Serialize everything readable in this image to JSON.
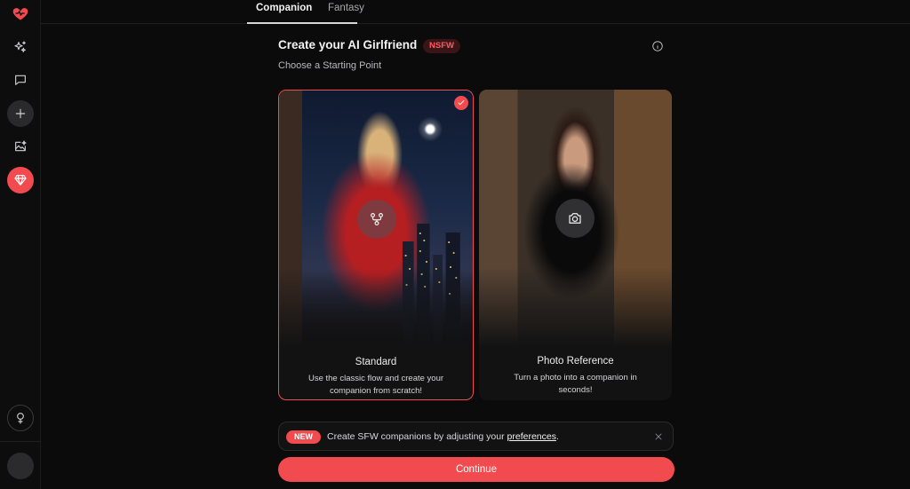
{
  "sidebar": {
    "items": [
      {
        "name": "logo-heart-icon"
      },
      {
        "name": "sparkles-icon"
      },
      {
        "name": "chat-icon"
      },
      {
        "name": "plus-icon"
      },
      {
        "name": "image-sparkle-icon"
      },
      {
        "name": "diamond-icon"
      },
      {
        "name": "gender-icon"
      }
    ]
  },
  "tabs": [
    {
      "label": "Companion",
      "active": true
    },
    {
      "label": "Fantasy",
      "active": false
    }
  ],
  "header": {
    "title": "Create your AI Girlfriend",
    "badge": "NSFW",
    "subtitle": "Choose a Starting Point"
  },
  "cards": [
    {
      "title": "Standard",
      "description": "Use the classic flow and create your companion from scratch!",
      "selected": true,
      "icon": "flow-icon"
    },
    {
      "title": "Photo Reference",
      "description": "Turn a photo into a companion in seconds!",
      "selected": false,
      "icon": "camera-icon"
    }
  ],
  "banner": {
    "badge": "NEW",
    "text_before": "Create SFW companions by adjusting your ",
    "link": "preferences",
    "text_after": "."
  },
  "continue_label": "Continue",
  "colors": {
    "accent": "#f24b4f",
    "background": "#0b0b0c"
  }
}
